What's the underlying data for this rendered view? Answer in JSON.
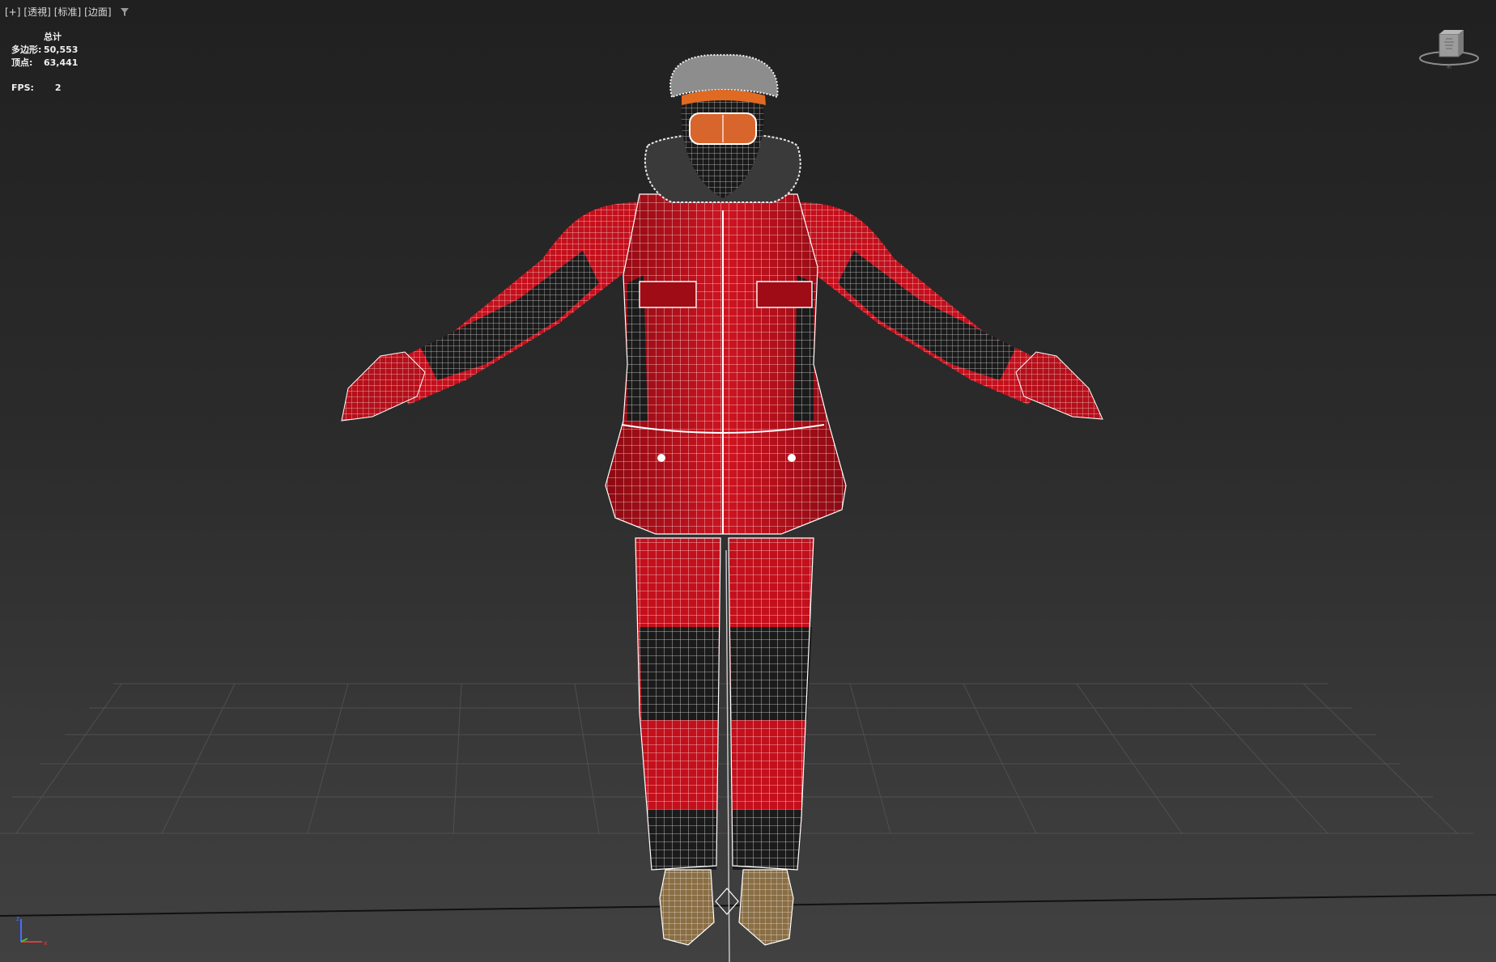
{
  "viewport": {
    "labels": [
      "[+]",
      "[透視]",
      "[标准]",
      "[边面]"
    ],
    "filter_icon": "filter-icon"
  },
  "stats": {
    "header": "总计",
    "polygons_label": "多边形:",
    "polygons_value": "50,553",
    "vertices_label": "顶点:",
    "vertices_value": "63,441"
  },
  "fps": {
    "label": "FPS:",
    "value": "2"
  },
  "viewcube": {
    "icon": "viewcube-icon"
  },
  "axis": {
    "icon": "axis-tripod-icon"
  },
  "colors": {
    "jacket": "#c4101c",
    "jacket_dark": "#8a0a12",
    "black_panel": "#1b1b1b",
    "wire": "#ffffff",
    "boots": "#8a6e44",
    "goggles": "#d8652c",
    "grid_line": "#575757",
    "background_top": "#202020",
    "background_bottom": "#414141"
  }
}
